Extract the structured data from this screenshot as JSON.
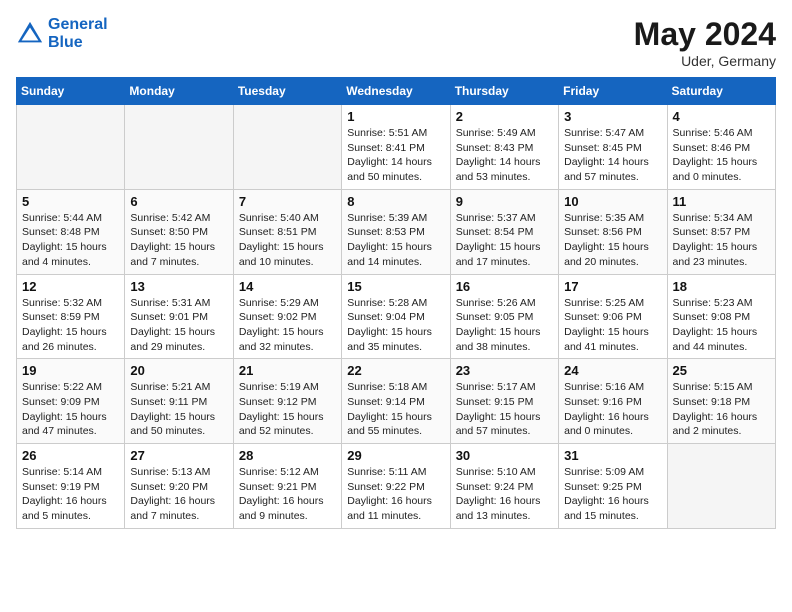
{
  "header": {
    "logo_line1": "General",
    "logo_line2": "Blue",
    "month": "May 2024",
    "location": "Uder, Germany"
  },
  "weekdays": [
    "Sunday",
    "Monday",
    "Tuesday",
    "Wednesday",
    "Thursday",
    "Friday",
    "Saturday"
  ],
  "weeks": [
    [
      {
        "day": "",
        "info": ""
      },
      {
        "day": "",
        "info": ""
      },
      {
        "day": "",
        "info": ""
      },
      {
        "day": "1",
        "info": "Sunrise: 5:51 AM\nSunset: 8:41 PM\nDaylight: 14 hours\nand 50 minutes."
      },
      {
        "day": "2",
        "info": "Sunrise: 5:49 AM\nSunset: 8:43 PM\nDaylight: 14 hours\nand 53 minutes."
      },
      {
        "day": "3",
        "info": "Sunrise: 5:47 AM\nSunset: 8:45 PM\nDaylight: 14 hours\nand 57 minutes."
      },
      {
        "day": "4",
        "info": "Sunrise: 5:46 AM\nSunset: 8:46 PM\nDaylight: 15 hours\nand 0 minutes."
      }
    ],
    [
      {
        "day": "5",
        "info": "Sunrise: 5:44 AM\nSunset: 8:48 PM\nDaylight: 15 hours\nand 4 minutes."
      },
      {
        "day": "6",
        "info": "Sunrise: 5:42 AM\nSunset: 8:50 PM\nDaylight: 15 hours\nand 7 minutes."
      },
      {
        "day": "7",
        "info": "Sunrise: 5:40 AM\nSunset: 8:51 PM\nDaylight: 15 hours\nand 10 minutes."
      },
      {
        "day": "8",
        "info": "Sunrise: 5:39 AM\nSunset: 8:53 PM\nDaylight: 15 hours\nand 14 minutes."
      },
      {
        "day": "9",
        "info": "Sunrise: 5:37 AM\nSunset: 8:54 PM\nDaylight: 15 hours\nand 17 minutes."
      },
      {
        "day": "10",
        "info": "Sunrise: 5:35 AM\nSunset: 8:56 PM\nDaylight: 15 hours\nand 20 minutes."
      },
      {
        "day": "11",
        "info": "Sunrise: 5:34 AM\nSunset: 8:57 PM\nDaylight: 15 hours\nand 23 minutes."
      }
    ],
    [
      {
        "day": "12",
        "info": "Sunrise: 5:32 AM\nSunset: 8:59 PM\nDaylight: 15 hours\nand 26 minutes."
      },
      {
        "day": "13",
        "info": "Sunrise: 5:31 AM\nSunset: 9:01 PM\nDaylight: 15 hours\nand 29 minutes."
      },
      {
        "day": "14",
        "info": "Sunrise: 5:29 AM\nSunset: 9:02 PM\nDaylight: 15 hours\nand 32 minutes."
      },
      {
        "day": "15",
        "info": "Sunrise: 5:28 AM\nSunset: 9:04 PM\nDaylight: 15 hours\nand 35 minutes."
      },
      {
        "day": "16",
        "info": "Sunrise: 5:26 AM\nSunset: 9:05 PM\nDaylight: 15 hours\nand 38 minutes."
      },
      {
        "day": "17",
        "info": "Sunrise: 5:25 AM\nSunset: 9:06 PM\nDaylight: 15 hours\nand 41 minutes."
      },
      {
        "day": "18",
        "info": "Sunrise: 5:23 AM\nSunset: 9:08 PM\nDaylight: 15 hours\nand 44 minutes."
      }
    ],
    [
      {
        "day": "19",
        "info": "Sunrise: 5:22 AM\nSunset: 9:09 PM\nDaylight: 15 hours\nand 47 minutes."
      },
      {
        "day": "20",
        "info": "Sunrise: 5:21 AM\nSunset: 9:11 PM\nDaylight: 15 hours\nand 50 minutes."
      },
      {
        "day": "21",
        "info": "Sunrise: 5:19 AM\nSunset: 9:12 PM\nDaylight: 15 hours\nand 52 minutes."
      },
      {
        "day": "22",
        "info": "Sunrise: 5:18 AM\nSunset: 9:14 PM\nDaylight: 15 hours\nand 55 minutes."
      },
      {
        "day": "23",
        "info": "Sunrise: 5:17 AM\nSunset: 9:15 PM\nDaylight: 15 hours\nand 57 minutes."
      },
      {
        "day": "24",
        "info": "Sunrise: 5:16 AM\nSunset: 9:16 PM\nDaylight: 16 hours\nand 0 minutes."
      },
      {
        "day": "25",
        "info": "Sunrise: 5:15 AM\nSunset: 9:18 PM\nDaylight: 16 hours\nand 2 minutes."
      }
    ],
    [
      {
        "day": "26",
        "info": "Sunrise: 5:14 AM\nSunset: 9:19 PM\nDaylight: 16 hours\nand 5 minutes."
      },
      {
        "day": "27",
        "info": "Sunrise: 5:13 AM\nSunset: 9:20 PM\nDaylight: 16 hours\nand 7 minutes."
      },
      {
        "day": "28",
        "info": "Sunrise: 5:12 AM\nSunset: 9:21 PM\nDaylight: 16 hours\nand 9 minutes."
      },
      {
        "day": "29",
        "info": "Sunrise: 5:11 AM\nSunset: 9:22 PM\nDaylight: 16 hours\nand 11 minutes."
      },
      {
        "day": "30",
        "info": "Sunrise: 5:10 AM\nSunset: 9:24 PM\nDaylight: 16 hours\nand 13 minutes."
      },
      {
        "day": "31",
        "info": "Sunrise: 5:09 AM\nSunset: 9:25 PM\nDaylight: 16 hours\nand 15 minutes."
      },
      {
        "day": "",
        "info": ""
      }
    ]
  ]
}
